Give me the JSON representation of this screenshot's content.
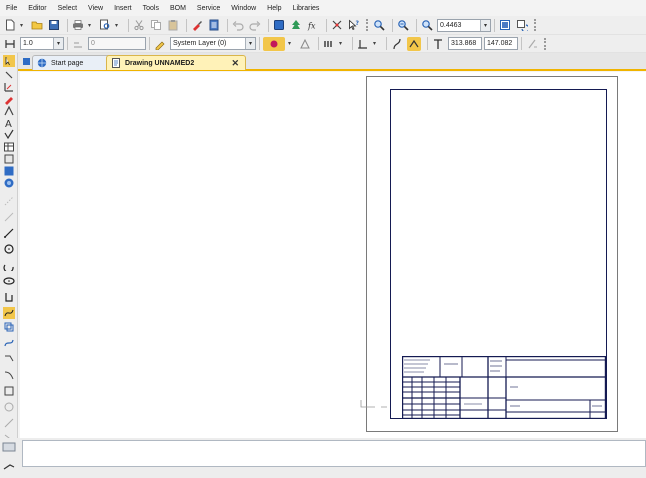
{
  "menubar": {
    "items": [
      "File",
      "Editor",
      "Select",
      "View",
      "Insert",
      "Tools",
      "BOM",
      "Service",
      "Window",
      "Help",
      "Libraries"
    ]
  },
  "toolbar_main": {
    "zoom_value": "0.4463"
  },
  "toolbar_props": {
    "line_width_value": "1.0",
    "offset_value": "0",
    "layer_value": "System Layer (0)",
    "coord_x": "313.868",
    "coord_y": "147.082"
  },
  "tabs": [
    {
      "label": "Start page",
      "active": false
    },
    {
      "label": "Drawing UNNAMED2",
      "active": true
    }
  ],
  "tab_close_glyph": "✕",
  "colors": {
    "active_tab": "#fff2b8",
    "tab_accent": "#f0b400",
    "frame": "#141a52"
  }
}
